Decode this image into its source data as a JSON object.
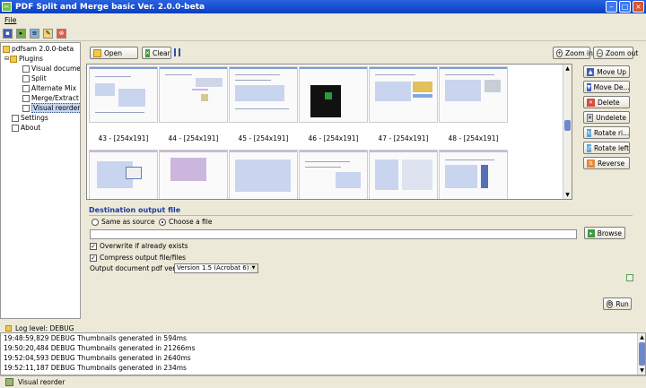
{
  "window": {
    "title": "PDF Split and Merge basic Ver. 2.0.0-beta"
  },
  "menu": {
    "items": [
      "File"
    ]
  },
  "tree": {
    "root": "pdfsam 2.0.0-beta",
    "plugins": "Plugins",
    "plugin_items": [
      "Visual documen",
      "Split",
      "Alternate Mix",
      "Merge/Extract",
      "Visual reorder"
    ],
    "selected": "Visual reorder",
    "settings": "Settings",
    "about": "About"
  },
  "thumbs_toolbar": {
    "open": "Open",
    "clear": "Clear",
    "zoom_in": "Zoom in",
    "zoom_out": "Zoom out"
  },
  "thumbnails": {
    "captions": [
      "43 - [254x191]",
      "44 - [254x191]",
      "45 - [254x191]",
      "46 - [254x191]",
      "47 - [254x191]",
      "48 - [254x191]"
    ]
  },
  "actions": {
    "move_up": "Move Up",
    "move_down": "Move De...",
    "delete": "Delete",
    "undelete": "Undelete",
    "rotate_right": "Rotate ri...",
    "rotate_left": "Rotate left",
    "reverse": "Reverse"
  },
  "destination": {
    "title": "Destination output file",
    "same_as_source": "Same as source",
    "choose_file": "Choose a file",
    "file_value": "",
    "browse": "Browse",
    "overwrite": "Overwrite if already exists",
    "compress": "Compress output file/files",
    "version_label": "Output document pdf version:",
    "version_value": "Version 1.5 (Acrobat 6)",
    "run": "Run"
  },
  "log": {
    "level": "Log level: DEBUG",
    "entries": [
      "19:48:59,829 DEBUG  Thumbnails generated in 594ms",
      "19:50:20,484 DEBUG  Thumbnails generated in 21266ms",
      "19:52:04,593 DEBUG  Thumbnails generated in 2640ms",
      "19:52:11,187 DEBUG  Thumbnails generated in 234ms"
    ]
  },
  "status": {
    "text": "Visual reorder"
  }
}
